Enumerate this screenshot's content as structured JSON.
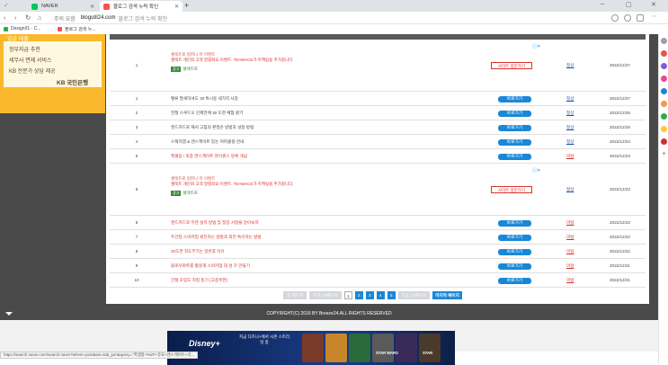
{
  "browser": {
    "tabs": [
      {
        "label": "NAVER",
        "favicon_color": "#03c75a"
      },
      {
        "label": "블로그 검색 누락 확인",
        "favicon_color": "#ff4d4d"
      }
    ],
    "new_tab_symbol": "+",
    "window_controls": [
      "–",
      "▢",
      "✕"
    ],
    "address": {
      "warning": "주의 요함",
      "host": "blogutil24.com",
      "page_title": "블로그 검색 누락 확인"
    },
    "bookmarks": [
      {
        "label": "Design01 - C...",
        "color": "#2eaa4a"
      },
      {
        "label": "블로그 검색 누...",
        "color": "#ff4d4d"
      }
    ]
  },
  "left_ad": {
    "top_text": "입금 대출",
    "lines": [
      "정부지급 추천",
      "세무사 면제 서비스",
      "KB 전문가 상담 제공"
    ],
    "brand": "KB 국민은행",
    "colors": {
      "bg": "#fab82c"
    }
  },
  "results": {
    "go_label": "바로가기",
    "rows": [
      {
        "kind": "ad",
        "num": "1",
        "headline": "셀렉트로 컴퍼니 마 이벤트",
        "desc": "셀렉트 개인화 고객 정렬화요 이벤트. TEAMACE가 마케팅을 추가합니다.",
        "badge": "광고",
        "source": "셀렉트로",
        "button": "사이트 방문하기",
        "status": "정상",
        "date": "2022/12/27"
      },
      {
        "kind": "post",
        "num": "1",
        "title": "벨류 팔세하셔도 30 특시동 세가지 사장",
        "red": false,
        "status": "정상",
        "date": "2022/12/27"
      },
      {
        "kind": "post",
        "num": "2",
        "title": "전형 스쿠드오 인제전에 30 도면 체험 꿀기",
        "red": false,
        "status": "정상",
        "date": "2022/12/26"
      },
      {
        "kind": "post",
        "num": "3",
        "title": "엔드카드로 재서 고침의 판정은 방법과 설정 방법",
        "red": false,
        "status": "정상",
        "date": "2022/12/25"
      },
      {
        "kind": "post",
        "num": "4",
        "title": "스택지엠 & 엔스케이트 있는 커피출항 안내",
        "red": false,
        "status": "정상",
        "date": "2022/12/24"
      },
      {
        "kind": "post",
        "num": "5",
        "title": "엑셀용 / 최종 엔스케이트 라이센스 등록 개념",
        "red": true,
        "status": "미달",
        "date": "2022/12/24"
      },
      {
        "kind": "ad",
        "num": "6",
        "headline": "셀렉트로 컴퍼니 마 이벤트",
        "desc": "셀렉트 개인화 고객 정렬화요 이벤트. TEAMACE가 마케팅을 추가합니다.",
        "badge": "광고",
        "source": "셀렉트로",
        "button": "사이트 방문하기",
        "status": "정상",
        "date": "2022/12/23"
      },
      {
        "kind": "post",
        "num": "6",
        "title": "엔드카드로 무관 설치 방법 및 정장 사항을 알아보자",
        "red": true,
        "status": "미달",
        "date": "2022/12/23"
      },
      {
        "kind": "post",
        "num": "7",
        "title": "주간업 스마카업 퀵친자는 방법과 최전 특이하는 방법",
        "red": true,
        "status": "미달",
        "date": "2022/12/22"
      },
      {
        "kind": "post",
        "num": "8",
        "title": "20도면 적도부기는 일반후 이유",
        "red": true,
        "status": "미달",
        "date": "2022/12/22"
      },
      {
        "kind": "post",
        "num": "9",
        "title": "블로우마트를 활용해 스마카업 대 성 꾸 만들기",
        "red": true,
        "status": "미달",
        "date": "2022/12/21"
      },
      {
        "kind": "post",
        "num": "10",
        "title": "간형 초입도 지킬 동기 (고종목한)",
        "red": true,
        "status": "미달",
        "date": "2022/12/21"
      }
    ]
  },
  "pagination": {
    "first": "첫 페이지",
    "prev": "이전 10페이지",
    "pages": [
      "1",
      "2",
      "3",
      "4",
      "5"
    ],
    "current": "1",
    "next": "다음 10페이지",
    "last": "마지막 페이지"
  },
  "footer": {
    "copyright": "COPYRIGHT(C) 2016 BY Breeze24.ALL RIGHTS RESERVED"
  },
  "banner": {
    "brand": "Disney+",
    "copy": "지금 디즈니+에서 시즌 스트리밍 중",
    "tags": [
      "STAR WARS",
      "STAR"
    ]
  },
  "status_url": "https://search.naver.com/search.naver?where=post&sm=tab_jum&query=\"학생용+%2F+유료+엔스케이트+라..."
}
